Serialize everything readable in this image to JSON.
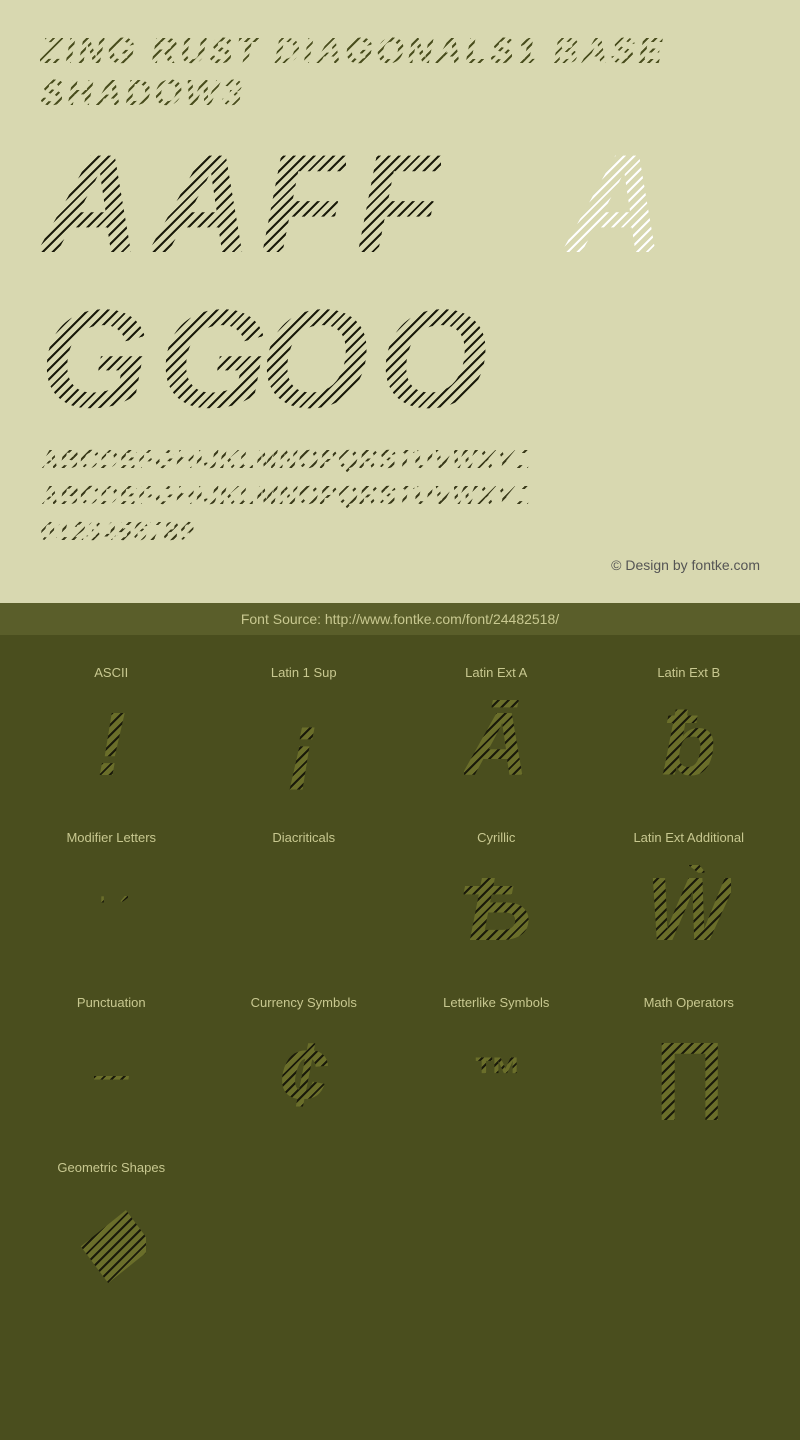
{
  "header": {
    "title": "ZING RUST DIAGONALS1 BASE SHADOW3"
  },
  "glyphs": {
    "row1_left": "AA",
    "row1_mid": "FF",
    "row1_right": "A",
    "row2_left": "GG",
    "row2_mid": "OO"
  },
  "alphabets": {
    "uppercase": "ABCDEFGHIJKLMNOPQRSTUVWXYZ",
    "lowercase": "ABCDEFGHIJKLMNOPQRSTUVWXYZ",
    "numbers": "0123456789"
  },
  "copyright": "© Design by fontke.com",
  "source": {
    "label": "Font Source: http://www.fontke.com/font/24482518/"
  },
  "charsets": [
    {
      "id": "ascii",
      "label": "ASCII",
      "glyph": "!",
      "size": "large"
    },
    {
      "id": "latin1sup",
      "label": "Latin 1 Sup",
      "glyph": "¡",
      "size": "large"
    },
    {
      "id": "latinexta",
      "label": "Latin Ext A",
      "glyph": "Ā",
      "size": "large"
    },
    {
      "id": "latinextb",
      "label": "Latin Ext B",
      "glyph": "ƀ",
      "size": "large"
    },
    {
      "id": "modletters",
      "label": "Modifier Letters",
      "glyph": "ˈ ˊ",
      "size": "small"
    },
    {
      "id": "diacriticals",
      "label": "Diacriticals",
      "glyph": "",
      "size": "none"
    },
    {
      "id": "cyrillic",
      "label": "Cyrillic",
      "glyph": "Ѣ",
      "size": "large"
    },
    {
      "id": "latinextadd",
      "label": "Latin Ext Additional",
      "glyph": "Ẁ",
      "size": "large"
    },
    {
      "id": "punctuation",
      "label": "Punctuation",
      "glyph": "—",
      "size": "small"
    },
    {
      "id": "currencysymbols",
      "label": "Currency Symbols",
      "glyph": "¢",
      "size": "large"
    },
    {
      "id": "letterlikesymbols",
      "label": "Letterlike Symbols",
      "glyph": "™",
      "size": "large"
    },
    {
      "id": "mathoperators",
      "label": "Math Operators",
      "glyph": "∏",
      "size": "large"
    },
    {
      "id": "geometricshapes",
      "label": "Geometric Shapes",
      "glyph": "◆",
      "size": "large"
    }
  ]
}
